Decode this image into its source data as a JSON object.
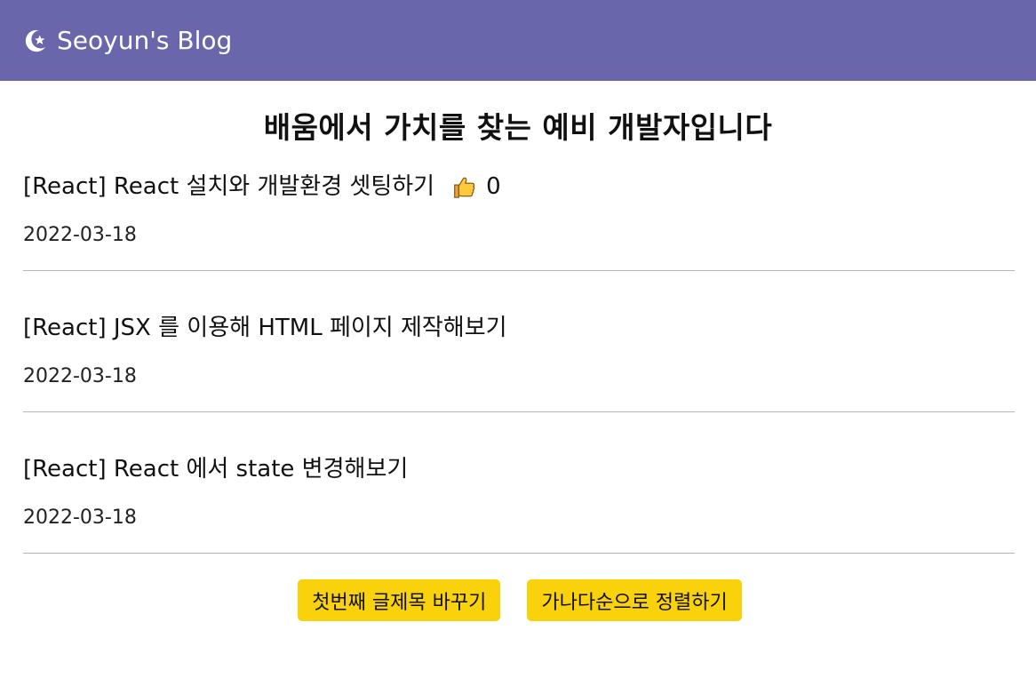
{
  "nav": {
    "brand_icon": "moon-star-icon",
    "title": "Seoyun's Blog",
    "color": "#6a66ab"
  },
  "headline": "배움에서 가치를 찾는 예비 개발자입니다",
  "posts": [
    {
      "title": "[React] React 설치와 개발환경 셋팅하기",
      "likes": "0",
      "like_icon": "thumbs-up-icon",
      "date": "2022-03-18"
    },
    {
      "title": "[React] JSX 를 이용해 HTML 페이지 제작해보기",
      "date": "2022-03-18"
    },
    {
      "title": "[React] React 에서 state 변경해보기",
      "date": "2022-03-18"
    }
  ],
  "buttons": {
    "change_title": "첫번째 글제목 바꾸기",
    "sort": "가나다순으로 정렬하기",
    "color": "#fad20b"
  }
}
